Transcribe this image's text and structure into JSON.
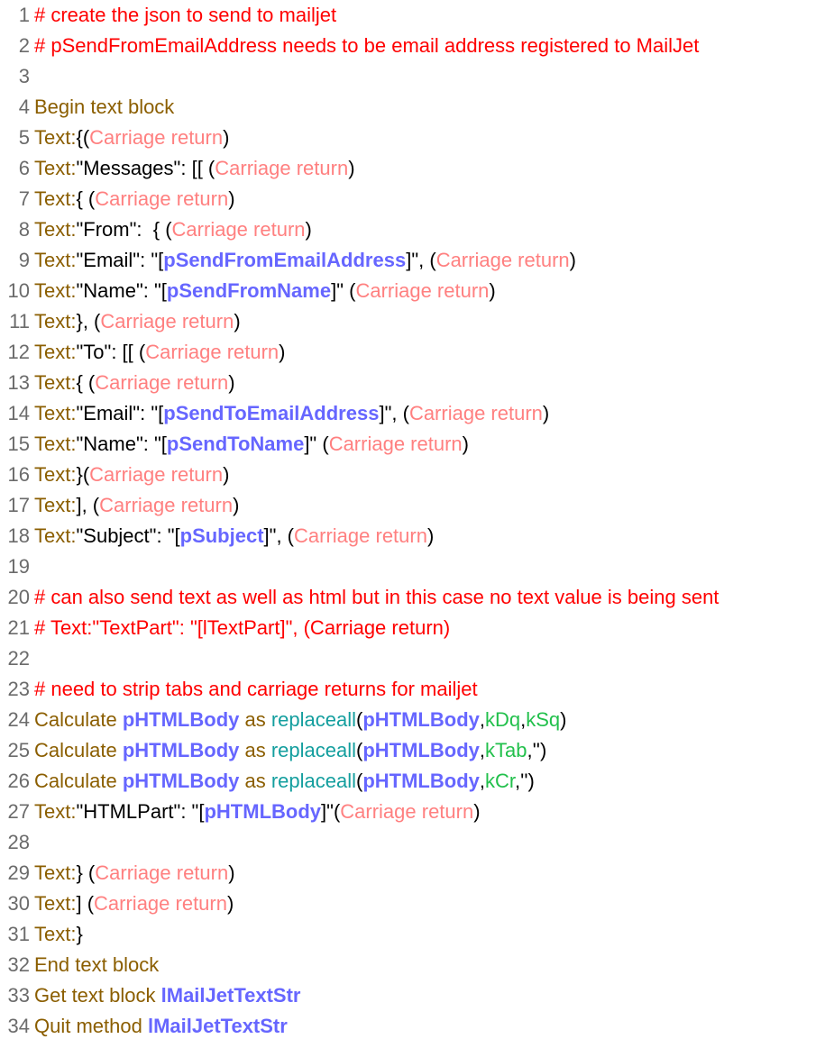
{
  "editor": {
    "lines": [
      {
        "num": "1",
        "tokens": [
          {
            "t": "comment",
            "v": "# create the json to send to mailjet"
          }
        ]
      },
      {
        "num": "2",
        "tokens": [
          {
            "t": "comment",
            "v": "# pSendFromEmailAddress needs to be email address registered to MailJet"
          }
        ]
      },
      {
        "num": "3",
        "tokens": []
      },
      {
        "num": "4",
        "tokens": [
          {
            "t": "cmd",
            "v": "Begin text block"
          }
        ]
      },
      {
        "num": "5",
        "tokens": [
          {
            "t": "cmd",
            "v": "Text:"
          },
          {
            "t": "text",
            "v": "{("
          },
          {
            "t": "cr",
            "v": "Carriage return"
          },
          {
            "t": "text",
            "v": ")"
          }
        ]
      },
      {
        "num": "6",
        "tokens": [
          {
            "t": "cmd",
            "v": "Text:"
          },
          {
            "t": "text",
            "v": "\"Messages\": [[ ("
          },
          {
            "t": "cr",
            "v": "Carriage return"
          },
          {
            "t": "text",
            "v": ")"
          }
        ]
      },
      {
        "num": "7",
        "tokens": [
          {
            "t": "cmd",
            "v": "Text:"
          },
          {
            "t": "text",
            "v": "{ ("
          },
          {
            "t": "cr",
            "v": "Carriage return"
          },
          {
            "t": "text",
            "v": ")"
          }
        ]
      },
      {
        "num": "8",
        "tokens": [
          {
            "t": "cmd",
            "v": "Text:"
          },
          {
            "t": "text",
            "v": "\"From\":  { ("
          },
          {
            "t": "cr",
            "v": "Carriage return"
          },
          {
            "t": "text",
            "v": ")"
          }
        ]
      },
      {
        "num": "9",
        "tokens": [
          {
            "t": "cmd",
            "v": "Text:"
          },
          {
            "t": "text",
            "v": "\"Email\": \"["
          },
          {
            "t": "var",
            "v": "pSendFromEmailAddress"
          },
          {
            "t": "text",
            "v": "]\", ("
          },
          {
            "t": "cr",
            "v": "Carriage return"
          },
          {
            "t": "text",
            "v": ")"
          }
        ]
      },
      {
        "num": "10",
        "tokens": [
          {
            "t": "cmd",
            "v": "Text:"
          },
          {
            "t": "text",
            "v": "\"Name\": \"["
          },
          {
            "t": "var",
            "v": "pSendFromName"
          },
          {
            "t": "text",
            "v": "]\" ("
          },
          {
            "t": "cr",
            "v": "Carriage return"
          },
          {
            "t": "text",
            "v": ")"
          }
        ]
      },
      {
        "num": "11",
        "tokens": [
          {
            "t": "cmd",
            "v": "Text:"
          },
          {
            "t": "text",
            "v": "}, ("
          },
          {
            "t": "cr",
            "v": "Carriage return"
          },
          {
            "t": "text",
            "v": ")"
          }
        ]
      },
      {
        "num": "12",
        "tokens": [
          {
            "t": "cmd",
            "v": "Text:"
          },
          {
            "t": "text",
            "v": "\"To\": [[ ("
          },
          {
            "t": "cr",
            "v": "Carriage return"
          },
          {
            "t": "text",
            "v": ")"
          }
        ]
      },
      {
        "num": "13",
        "tokens": [
          {
            "t": "cmd",
            "v": "Text:"
          },
          {
            "t": "text",
            "v": "{ ("
          },
          {
            "t": "cr",
            "v": "Carriage return"
          },
          {
            "t": "text",
            "v": ")"
          }
        ]
      },
      {
        "num": "14",
        "tokens": [
          {
            "t": "cmd",
            "v": "Text:"
          },
          {
            "t": "text",
            "v": "\"Email\": \"["
          },
          {
            "t": "var",
            "v": "pSendToEmailAddress"
          },
          {
            "t": "text",
            "v": "]\", ("
          },
          {
            "t": "cr",
            "v": "Carriage return"
          },
          {
            "t": "text",
            "v": ")"
          }
        ]
      },
      {
        "num": "15",
        "tokens": [
          {
            "t": "cmd",
            "v": "Text:"
          },
          {
            "t": "text",
            "v": "\"Name\": \"["
          },
          {
            "t": "var",
            "v": "pSendToName"
          },
          {
            "t": "text",
            "v": "]\" ("
          },
          {
            "t": "cr",
            "v": "Carriage return"
          },
          {
            "t": "text",
            "v": ")"
          }
        ]
      },
      {
        "num": "16",
        "tokens": [
          {
            "t": "cmd",
            "v": "Text:"
          },
          {
            "t": "text",
            "v": "}("
          },
          {
            "t": "cr",
            "v": "Carriage return"
          },
          {
            "t": "text",
            "v": ")"
          }
        ]
      },
      {
        "num": "17",
        "tokens": [
          {
            "t": "cmd",
            "v": "Text:"
          },
          {
            "t": "text",
            "v": "], ("
          },
          {
            "t": "cr",
            "v": "Carriage return"
          },
          {
            "t": "text",
            "v": ")"
          }
        ]
      },
      {
        "num": "18",
        "tokens": [
          {
            "t": "cmd",
            "v": "Text:"
          },
          {
            "t": "text",
            "v": "\"Subject\": \"["
          },
          {
            "t": "var",
            "v": "pSubject"
          },
          {
            "t": "text",
            "v": "]\", ("
          },
          {
            "t": "cr",
            "v": "Carriage return"
          },
          {
            "t": "text",
            "v": ")"
          }
        ]
      },
      {
        "num": "19",
        "tokens": []
      },
      {
        "num": "20",
        "tokens": [
          {
            "t": "comment",
            "v": "# can also send text as well as html but in this case no text value is being sent"
          }
        ]
      },
      {
        "num": "21",
        "tokens": [
          {
            "t": "comment",
            "v": "# Text:\"TextPart\": \"[lTextPart]\", (Carriage return)"
          }
        ]
      },
      {
        "num": "22",
        "tokens": []
      },
      {
        "num": "23",
        "tokens": [
          {
            "t": "comment",
            "v": "# need to strip tabs and carriage returns for mailjet"
          }
        ]
      },
      {
        "num": "24",
        "tokens": [
          {
            "t": "cmd",
            "v": "Calculate "
          },
          {
            "t": "var",
            "v": "pHTMLBody"
          },
          {
            "t": "cmd",
            "v": " as "
          },
          {
            "t": "fn",
            "v": "replaceall"
          },
          {
            "t": "text",
            "v": "("
          },
          {
            "t": "var",
            "v": "pHTMLBody"
          },
          {
            "t": "text",
            "v": ","
          },
          {
            "t": "const",
            "v": "kDq"
          },
          {
            "t": "text",
            "v": ","
          },
          {
            "t": "const",
            "v": "kSq"
          },
          {
            "t": "text",
            "v": ")"
          }
        ]
      },
      {
        "num": "25",
        "tokens": [
          {
            "t": "cmd",
            "v": "Calculate "
          },
          {
            "t": "var",
            "v": "pHTMLBody"
          },
          {
            "t": "cmd",
            "v": " as "
          },
          {
            "t": "fn",
            "v": "replaceall"
          },
          {
            "t": "text",
            "v": "("
          },
          {
            "t": "var",
            "v": "pHTMLBody"
          },
          {
            "t": "text",
            "v": ","
          },
          {
            "t": "const",
            "v": "kTab"
          },
          {
            "t": "text",
            "v": ",'')"
          }
        ]
      },
      {
        "num": "26",
        "tokens": [
          {
            "t": "cmd",
            "v": "Calculate "
          },
          {
            "t": "var",
            "v": "pHTMLBody"
          },
          {
            "t": "cmd",
            "v": " as "
          },
          {
            "t": "fn",
            "v": "replaceall"
          },
          {
            "t": "text",
            "v": "("
          },
          {
            "t": "var",
            "v": "pHTMLBody"
          },
          {
            "t": "text",
            "v": ","
          },
          {
            "t": "const",
            "v": "kCr"
          },
          {
            "t": "text",
            "v": ",'')"
          }
        ]
      },
      {
        "num": "27",
        "tokens": [
          {
            "t": "cmd",
            "v": "Text:"
          },
          {
            "t": "text",
            "v": "\"HTMLPart\": \"["
          },
          {
            "t": "var",
            "v": "pHTMLBody"
          },
          {
            "t": "text",
            "v": "]\"("
          },
          {
            "t": "cr",
            "v": "Carriage return"
          },
          {
            "t": "text",
            "v": ")"
          }
        ]
      },
      {
        "num": "28",
        "tokens": []
      },
      {
        "num": "29",
        "tokens": [
          {
            "t": "cmd",
            "v": "Text:"
          },
          {
            "t": "text",
            "v": "} ("
          },
          {
            "t": "cr",
            "v": "Carriage return"
          },
          {
            "t": "text",
            "v": ")"
          }
        ]
      },
      {
        "num": "30",
        "tokens": [
          {
            "t": "cmd",
            "v": "Text:"
          },
          {
            "t": "text",
            "v": "] ("
          },
          {
            "t": "cr",
            "v": "Carriage return"
          },
          {
            "t": "text",
            "v": ")"
          }
        ]
      },
      {
        "num": "31",
        "tokens": [
          {
            "t": "cmd",
            "v": "Text:"
          },
          {
            "t": "text",
            "v": "}"
          }
        ]
      },
      {
        "num": "32",
        "tokens": [
          {
            "t": "cmd",
            "v": "End text block"
          }
        ]
      },
      {
        "num": "33",
        "tokens": [
          {
            "t": "cmd",
            "v": "Get text block "
          },
          {
            "t": "var",
            "v": "lMailJetTextStr"
          }
        ]
      },
      {
        "num": "34",
        "tokens": [
          {
            "t": "cmd",
            "v": "Quit method "
          },
          {
            "t": "var",
            "v": "lMailJetTextStr"
          }
        ]
      }
    ]
  },
  "colors": {
    "comment": "#ff0000",
    "command": "#8b5e00",
    "text": "#000000",
    "carriage_return": "#ff8080",
    "variable": "#6666ff",
    "function": "#139e9e",
    "constant": "#22c04c",
    "line_number": "#6b6b6b"
  }
}
